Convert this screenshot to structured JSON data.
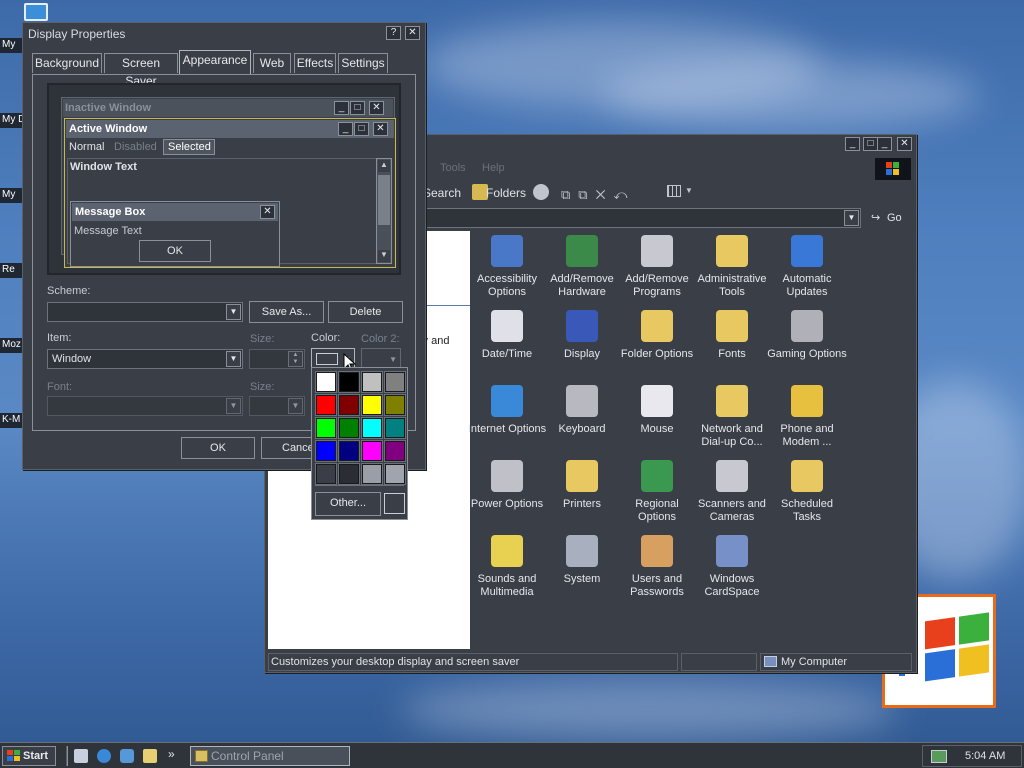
{
  "desktop": {
    "icons": [
      "My",
      "My D",
      "My",
      "Re",
      "Moz",
      "K-M"
    ]
  },
  "display_properties": {
    "title": "Display Properties",
    "tabs": [
      "Background",
      "Screen Saver",
      "Appearance",
      "Web",
      "Effects",
      "Settings"
    ],
    "active_tab": "Appearance",
    "preview": {
      "inactive_title": "Inactive Window",
      "active_title": "Active Window",
      "menu": [
        "Normal",
        "Disabled",
        "Selected"
      ],
      "window_text": "Window Text",
      "msgbox_title": "Message Box",
      "msgbox_text": "Message Text",
      "msgbox_ok": "OK"
    },
    "scheme_label": "Scheme:",
    "scheme_value": "",
    "save_as": "Save As...",
    "delete": "Delete",
    "item_label": "Item:",
    "item_value": "Window",
    "size_label": "Size:",
    "color_label": "Color:",
    "color2_label": "Color 2:",
    "font_label": "Font:",
    "font_size_label": "Size:",
    "ok": "OK",
    "cancel": "Cance"
  },
  "color_picker": {
    "colors": [
      "#ffffff",
      "#000000",
      "#c0c0c0",
      "#808080",
      "#ff0000",
      "#800000",
      "#ffff00",
      "#808000",
      "#00ff00",
      "#008000",
      "#00ffff",
      "#008080",
      "#0000ff",
      "#000080",
      "#ff00ff",
      "#800080",
      "#3a3f47",
      "#2a2e34",
      "#9a9ea6",
      "#a0a4ac"
    ],
    "other_label": "Other..."
  },
  "control_panel": {
    "menu_partial": [
      "Tools",
      "Help"
    ],
    "toolbar": {
      "search": "Search",
      "folders": "Folders"
    },
    "go": "Go",
    "left_text": "lay and",
    "icons": [
      {
        "label": "Accessibility Options",
        "icon": "accessibility-icon",
        "color": "#4a78c8"
      },
      {
        "label": "Add/Remove Hardware",
        "icon": "hardware-icon",
        "color": "#3c8a4a"
      },
      {
        "label": "Add/Remove Programs",
        "icon": "programs-icon",
        "color": "#c8c8d0"
      },
      {
        "label": "Administrative Tools",
        "icon": "admin-tools-icon",
        "color": "#e8c860"
      },
      {
        "label": "Automatic Updates",
        "icon": "windows-update-icon",
        "color": "#3a78d8"
      },
      {
        "label": "Date/Time",
        "icon": "clock-icon",
        "color": "#e0e0e8"
      },
      {
        "label": "Display",
        "icon": "display-icon",
        "color": "#3a58b8"
      },
      {
        "label": "Folder Options",
        "icon": "folder-options-icon",
        "color": "#e8c860"
      },
      {
        "label": "Fonts",
        "icon": "fonts-icon",
        "color": "#e8c860"
      },
      {
        "label": "Gaming Options",
        "icon": "joystick-icon",
        "color": "#b0b0b8"
      },
      {
        "label": "Internet Options",
        "icon": "globe-icon",
        "color": "#3a88d8"
      },
      {
        "label": "Keyboard",
        "icon": "keyboard-icon",
        "color": "#b8b8c0"
      },
      {
        "label": "Mouse",
        "icon": "mouse-icon",
        "color": "#e8e8ee"
      },
      {
        "label": "Network and Dial-up Co...",
        "icon": "network-icon",
        "color": "#e8c860"
      },
      {
        "label": "Phone and Modem ...",
        "icon": "phone-icon",
        "color": "#e8c040"
      },
      {
        "label": "Power Options",
        "icon": "power-icon",
        "color": "#c0c0c8"
      },
      {
        "label": "Printers",
        "icon": "printer-folder-icon",
        "color": "#e8c860"
      },
      {
        "label": "Regional Options",
        "icon": "globe-regional-icon",
        "color": "#3a9850"
      },
      {
        "label": "Scanners and Cameras",
        "icon": "scanner-icon",
        "color": "#c8c8d0"
      },
      {
        "label": "Scheduled Tasks",
        "icon": "scheduled-tasks-icon",
        "color": "#e8c860"
      },
      {
        "label": "Sounds and Multimedia",
        "icon": "speaker-icon",
        "color": "#e8d050"
      },
      {
        "label": "System",
        "icon": "computer-icon",
        "color": "#a8b0c0"
      },
      {
        "label": "Users and Passwords",
        "icon": "users-icon",
        "color": "#d8a060"
      },
      {
        "label": "Windows CardSpace",
        "icon": "cardspace-icon",
        "color": "#7890c8"
      }
    ],
    "status_left": "Customizes your desktop display and screen saver",
    "status_right": "My Computer"
  },
  "taskbar": {
    "start": "Start",
    "task": "Control Panel",
    "time": "5:04 AM"
  }
}
